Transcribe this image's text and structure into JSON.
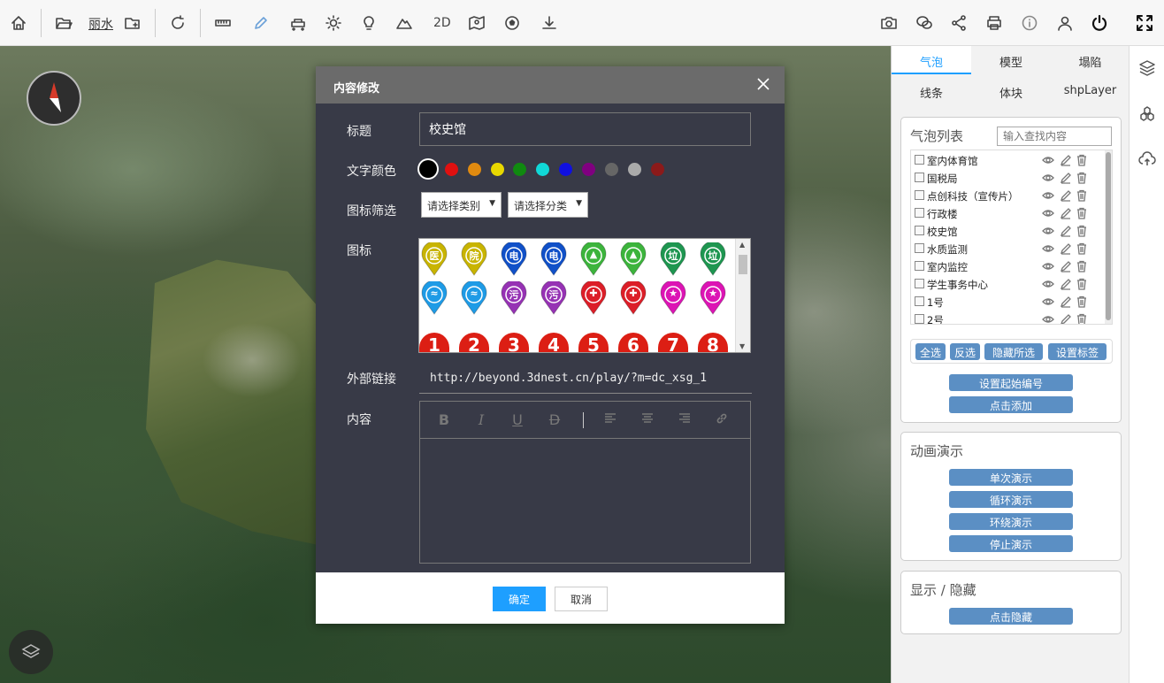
{
  "toolbar": {
    "city_label": "丽水",
    "mode_2d_label": "2D"
  },
  "modal": {
    "title": "内容修改",
    "labels": {
      "title": "标题",
      "text_color": "文字颜色",
      "icon_filter": "图标筛选",
      "icon": "图标",
      "external_link": "外部链接",
      "content": "内容"
    },
    "title_value": "校史馆",
    "colors": [
      "#000000",
      "#e01010",
      "#e08a10",
      "#e8d800",
      "#108a10",
      "#10d8d8",
      "#1010e0",
      "#800080",
      "#666666",
      "#aaaaaa",
      "#8b1a1a"
    ],
    "category_select": "请选择类别",
    "class_select": "请选择分类",
    "icons": {
      "row1": [
        {
          "glyph": "医",
          "color": "#c8b400"
        },
        {
          "glyph": "院",
          "color": "#c8b400"
        },
        {
          "glyph": "电",
          "color": "#1050c8"
        },
        {
          "glyph": "电",
          "color": "#1050c8"
        },
        {
          "glyph": "▲",
          "color": "#3cb43c"
        },
        {
          "glyph": "▲",
          "color": "#3cb43c"
        },
        {
          "glyph": "垃",
          "color": "#1e9650"
        },
        {
          "glyph": "垃",
          "color": "#1e9650"
        }
      ],
      "row2": [
        {
          "glyph": "≈",
          "color": "#1e9be6"
        },
        {
          "glyph": "≈",
          "color": "#1e9be6"
        },
        {
          "glyph": "污",
          "color": "#9632b4"
        },
        {
          "glyph": "污",
          "color": "#9632b4"
        },
        {
          "glyph": "✚",
          "color": "#dc1e28"
        },
        {
          "glyph": "✚",
          "color": "#dc1e28"
        },
        {
          "glyph": "★",
          "color": "#dc14b4"
        },
        {
          "glyph": "★",
          "color": "#dc14b4"
        }
      ],
      "row3": [
        "1",
        "2",
        "3",
        "4",
        "5",
        "6",
        "7",
        "8"
      ],
      "row3_color": "#dc1e14"
    },
    "link_value": "http://beyond.3dnest.cn/play/?m=dc_xsg_1",
    "ok_label": "确定",
    "cancel_label": "取消"
  },
  "panel": {
    "tabs_row1": [
      "气泡",
      "模型",
      "塌陷"
    ],
    "tabs_row2": [
      "线条",
      "体块",
      "shpLayer"
    ],
    "active_tab": "气泡",
    "bubble_list": {
      "title": "气泡列表",
      "search_placeholder": "输入查找内容",
      "items": [
        "室内体育馆",
        "国税局",
        "点创科技（宣传片）",
        "行政楼",
        "校史馆",
        "水质监测",
        "室内监控",
        "学生事务中心",
        "1号",
        "2号"
      ],
      "select_all": "全选",
      "invert": "反选",
      "hide_selected": "隐藏所选",
      "set_label": "设置标签",
      "set_start_number": "设置起始编号",
      "click_add": "点击添加"
    },
    "animation": {
      "title": "动画演示",
      "single": "单次演示",
      "loop": "循环演示",
      "orbit": "环绕演示",
      "stop": "停止演示"
    },
    "display": {
      "title": "显示 / 隐藏",
      "hide": "点击隐藏"
    }
  }
}
